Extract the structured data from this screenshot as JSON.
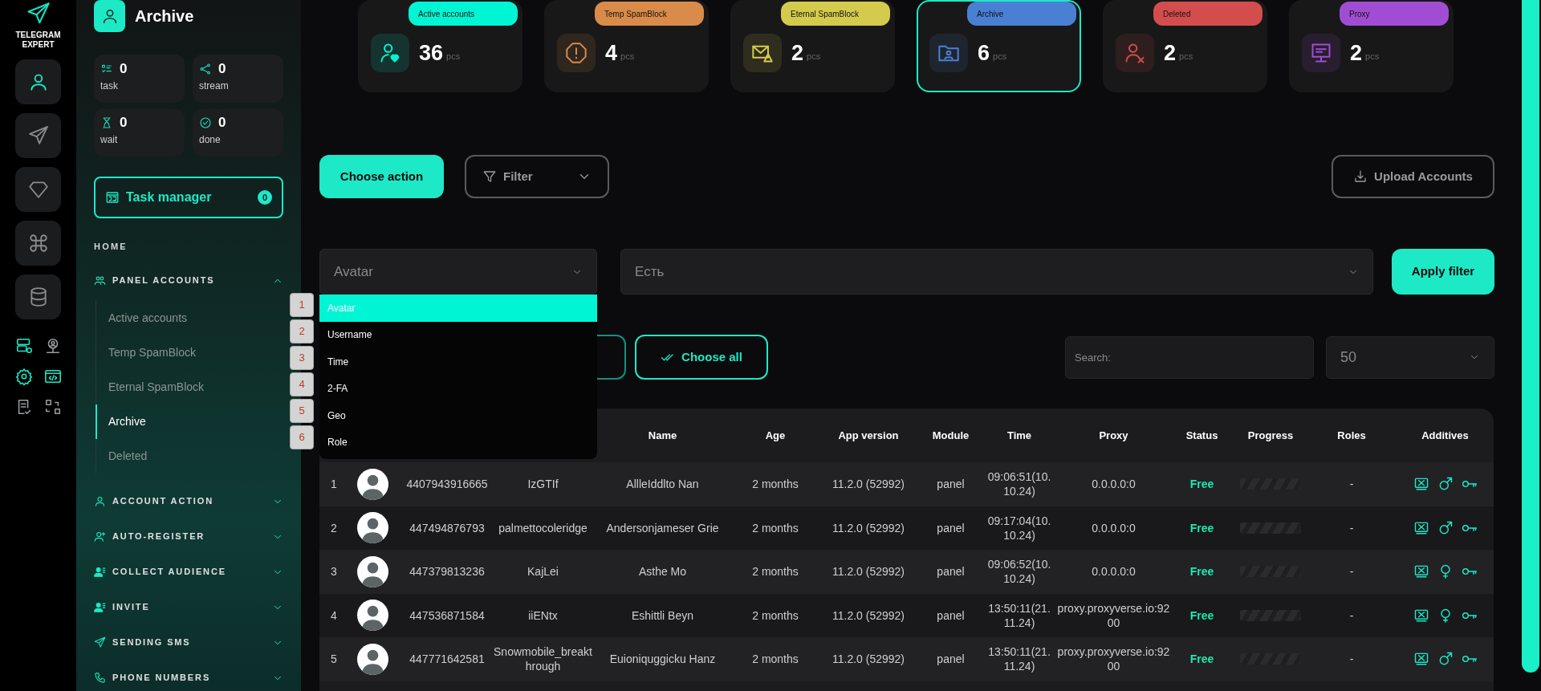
{
  "brand": {
    "name": "TELEGRAM EXPERT"
  },
  "rail": {
    "buttons": [
      {
        "selected": true
      },
      {
        "selected": false
      },
      {
        "selected": false
      },
      {
        "selected": false
      },
      {
        "selected": false
      }
    ],
    "tools": [
      {
        "active": true
      },
      {
        "active": false
      },
      {
        "active": true
      },
      {
        "active": true
      },
      {
        "active": false
      },
      {
        "active": false
      }
    ]
  },
  "page_title": "Archive",
  "counters": [
    {
      "value": "0",
      "label": "task"
    },
    {
      "value": "0",
      "label": "stream"
    },
    {
      "value": "0",
      "label": "wait"
    },
    {
      "value": "0",
      "label": "done"
    }
  ],
  "task_manager": {
    "label": "Task manager",
    "count": "0"
  },
  "menu": {
    "heading": "HOME",
    "sections": [
      {
        "label": "PANEL ACCOUNTS",
        "expanded": true,
        "children": [
          {
            "label": "Active accounts",
            "selected": false
          },
          {
            "label": "Temp SpamBlock",
            "selected": false
          },
          {
            "label": "Eternal SpamBlock",
            "selected": false
          },
          {
            "label": "Archive",
            "selected": true
          },
          {
            "label": "Deleted",
            "selected": false
          }
        ]
      },
      {
        "label": "ACCOUNT ACTION",
        "expanded": false
      },
      {
        "label": "AUTO-REGISTER",
        "expanded": false
      },
      {
        "label": "COLLECT AUDIENCE",
        "expanded": false
      },
      {
        "label": "INVITE",
        "expanded": false
      },
      {
        "label": "SENDING SMS",
        "expanded": false
      },
      {
        "label": "PHONE NUMBERS",
        "expanded": false
      }
    ]
  },
  "stat_cards": [
    {
      "label": "Active accounts",
      "count": "36",
      "unit": "pcs",
      "color": "#00f5d4",
      "selected": false
    },
    {
      "label": "Temp SpamBlock",
      "count": "4",
      "unit": "pcs",
      "color": "#d98b4a",
      "selected": false
    },
    {
      "label": "Eternal SpamBlock",
      "count": "2",
      "unit": "pcs",
      "color": "#d4cb4d",
      "selected": false
    },
    {
      "label": "Archive",
      "count": "6",
      "unit": "pcs",
      "color": "#4a80d4",
      "selected": true
    },
    {
      "label": "Deleted",
      "count": "2",
      "unit": "pcs",
      "color": "#d44d4d",
      "selected": false
    },
    {
      "label": "Proxy",
      "count": "2",
      "unit": "pcs",
      "color": "#a04dd4",
      "selected": false
    }
  ],
  "toolbar": {
    "choose_action": "Choose action",
    "filter": "Filter",
    "upload": "Upload Accounts"
  },
  "filter_row": {
    "field": "Avatar",
    "value": "Есть",
    "apply": "Apply filter"
  },
  "field_dropdown": {
    "options": [
      {
        "label": "Avatar",
        "selected": true,
        "marker": "1"
      },
      {
        "label": "Username",
        "selected": false,
        "marker": "2"
      },
      {
        "label": "Time",
        "selected": false,
        "marker": "3"
      },
      {
        "label": "2-FA",
        "selected": false,
        "marker": "4"
      },
      {
        "label": "Geo",
        "selected": false,
        "marker": "5"
      },
      {
        "label": "Role",
        "selected": false,
        "marker": "6"
      }
    ]
  },
  "choose_all_button": "Choose all",
  "search": {
    "placeholder": "Search:"
  },
  "page_size": "50",
  "table": {
    "columns": [
      "Name",
      "Age",
      "App version",
      "Module",
      "Time",
      "Proxy",
      "Status",
      "Progress",
      "Roles",
      "Additives"
    ],
    "rows": [
      {
        "num": "1",
        "phone": "4407943916665",
        "username": "IzGTIf",
        "name": "AllleIddlto Nan",
        "age": "2 months",
        "app_version": "11.2.0 (52992)",
        "module": "panel",
        "time": "09:06:51(10.10.24)",
        "proxy": "0.0.0.0:0",
        "status": "Free",
        "progress": {
          "level": 0
        },
        "roles": "-",
        "additives": [
          {
            "kind": "sim"
          },
          {
            "kind": "male"
          },
          {
            "kind": "key"
          }
        ]
      },
      {
        "num": "2",
        "phone": "447494876793",
        "username": "palmettocoleridge",
        "name": "Andersonjameser Grie",
        "age": "2 months",
        "app_version": "11.2.0 (52992)",
        "module": "panel",
        "time": "09:17:04(10.10.24)",
        "proxy": "0.0.0.0:0",
        "status": "Free",
        "progress": {
          "level": 0
        },
        "roles": "-",
        "additives": [
          {
            "kind": "sim"
          },
          {
            "kind": "male"
          },
          {
            "kind": "key"
          }
        ]
      },
      {
        "num": "3",
        "phone": "447379813236",
        "username": "KajLei",
        "name": "Asthe Mo",
        "age": "2 months",
        "app_version": "11.2.0 (52992)",
        "module": "panel",
        "time": "09:06:52(10.10.24)",
        "proxy": "0.0.0.0:0",
        "status": "Free",
        "progress": {
          "level": 0
        },
        "roles": "-",
        "additives": [
          {
            "kind": "sim"
          },
          {
            "kind": "female"
          },
          {
            "kind": "key"
          }
        ]
      },
      {
        "num": "4",
        "phone": "447536871584",
        "username": "iiENtx",
        "name": "Eshittli Beyn",
        "age": "2 months",
        "app_version": "11.2.0 (52992)",
        "module": "panel",
        "time": "13:50:11(21.11.24)",
        "proxy": "proxy.proxyverse.io:9200",
        "status": "Free",
        "progress": {
          "level": 0
        },
        "roles": "-",
        "additives": [
          {
            "kind": "sim"
          },
          {
            "kind": "female"
          },
          {
            "kind": "key"
          }
        ]
      },
      {
        "num": "5",
        "phone": "447771642581",
        "username": "Snowmobile_breakthrough",
        "name": "Euioniquggicku Hanz",
        "age": "2 months",
        "app_version": "11.2.0 (52992)",
        "module": "panel",
        "time": "13:50:11(21.11.24)",
        "proxy": "proxy.proxyverse.io:9200",
        "status": "Free",
        "progress": {
          "level": 0
        },
        "roles": "-",
        "additives": [
          {
            "kind": "sim"
          },
          {
            "kind": "male"
          },
          {
            "kind": "key"
          }
        ]
      }
    ]
  }
}
